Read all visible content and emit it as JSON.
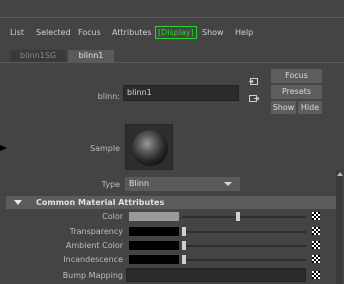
{
  "menu": {
    "items": [
      "List",
      "Selected",
      "Focus",
      "Attributes",
      "Display",
      "Show",
      "Help"
    ]
  },
  "tabs": [
    "blinn1SG",
    "blinn1"
  ],
  "active_tab": "blinn1",
  "node": {
    "label": "blinn:",
    "name": "blinn1"
  },
  "buttons": {
    "focus": "Focus",
    "presets": "Presets",
    "show": "Show",
    "hide": "Hide"
  },
  "sample": {
    "label": "Sample"
  },
  "type": {
    "label": "Type",
    "value": "Blinn"
  },
  "section": {
    "title": "Common Material Attributes"
  },
  "attributes": [
    {
      "label": "Color",
      "swatch": "#9a9a9a",
      "slider": 0.45
    },
    {
      "label": "Transparency",
      "swatch": "#000000",
      "slider": 0.0
    },
    {
      "label": "Ambient Color",
      "swatch": "#000000",
      "slider": 0.0
    },
    {
      "label": "Incandescence",
      "swatch": "#000000",
      "slider": 0.0
    },
    {
      "label": "Bump Mapping"
    }
  ],
  "colors": {
    "display_highlight": "#27d627",
    "panel_bg": "#444444",
    "section_bg": "#5c5c5c"
  }
}
